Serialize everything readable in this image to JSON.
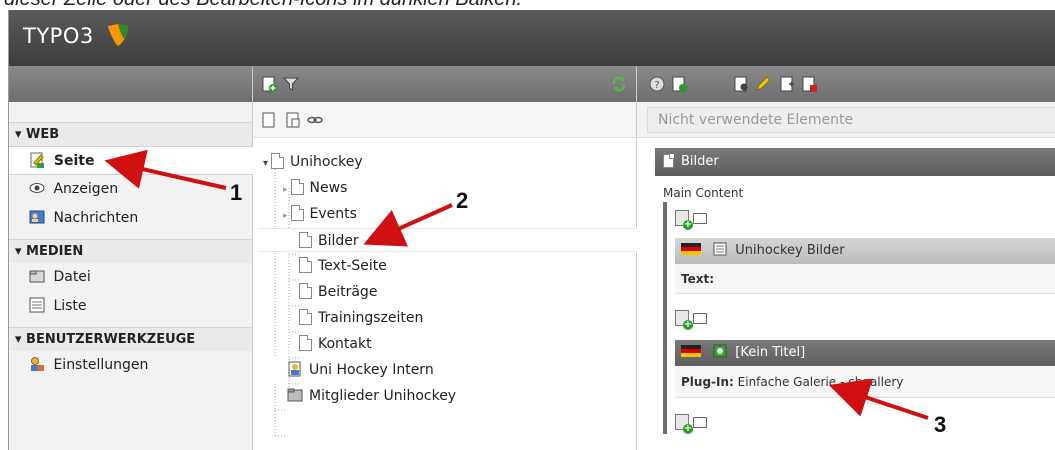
{
  "caption": "dieser Zeile oder des Bearbeiten-Icons im dunklen Balken.",
  "app": {
    "logo_text": "TYPO3"
  },
  "sidebar": {
    "groups": [
      {
        "label": "▾ WEB",
        "items": [
          {
            "label": "Seite",
            "icon": "page-module-icon",
            "active": true
          },
          {
            "label": "Anzeigen",
            "icon": "eye-icon"
          },
          {
            "label": "Nachrichten",
            "icon": "news-icon"
          }
        ]
      },
      {
        "label": "▾ MEDIEN",
        "items": [
          {
            "label": "Datei",
            "icon": "folder-icon"
          },
          {
            "label": "Liste",
            "icon": "list-icon"
          }
        ]
      },
      {
        "label": "▾ BENUTZERWERKZEUGE",
        "items": [
          {
            "label": "Einstellungen",
            "icon": "user-settings-icon"
          }
        ]
      }
    ]
  },
  "tree": {
    "root": "Unihockey",
    "children": [
      "News",
      "Events",
      "Bilder",
      "Text-Seite",
      "Beiträge",
      "Trainingszeiten",
      "Kontakt"
    ],
    "selected": "Bilder",
    "extra": [
      "Uni Hockey Intern",
      "Mitglieder Unihockey"
    ]
  },
  "content": {
    "unused_placeholder": "Nicht verwendete Elemente",
    "page_title": "Bilder",
    "column_label": "Main Content",
    "elements": [
      {
        "title": "Unihockey Bilder",
        "field_label": "Text:",
        "field_value": ""
      },
      {
        "title": "[Kein Titel]",
        "field_label": "Plug-In:",
        "field_value": "Einfache Galerie - chgallery"
      }
    ]
  },
  "annotations": {
    "one": "1",
    "two": "2",
    "three": "3"
  },
  "colors": {
    "arrow": "#d01010",
    "topbar": "#4a4a4a",
    "toolbar": "#7a7a7a"
  }
}
